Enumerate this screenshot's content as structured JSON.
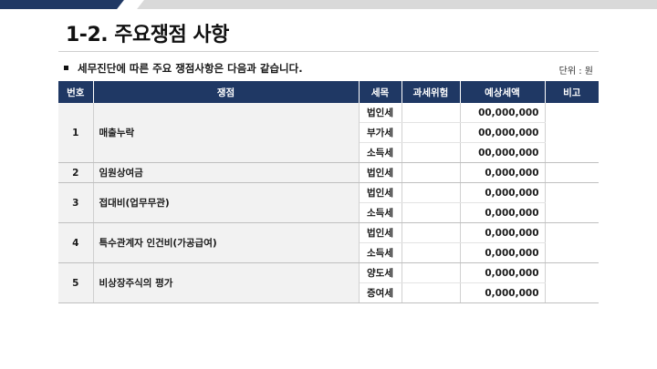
{
  "slide": {
    "title": "1-2. 주요쟁점 사항",
    "bullet": "세무진단에 따른 주요 쟁점사항은 다음과 같습니다.",
    "unit": "단위 : 원"
  },
  "table": {
    "headers": {
      "no": "번호",
      "issue": "쟁점",
      "tax_item": "세목",
      "risk": "과세위험",
      "amount": "예상세액",
      "note": "비고"
    },
    "groups": [
      {
        "no": "1",
        "issue": "매출누락",
        "rows": [
          {
            "tax": "법인세",
            "risk": "",
            "amount": "00,000,000"
          },
          {
            "tax": "부가세",
            "risk": "",
            "amount": "00,000,000"
          },
          {
            "tax": "소득세",
            "risk": "",
            "amount": "00,000,000"
          }
        ]
      },
      {
        "no": "2",
        "issue": "임원상여금",
        "rows": [
          {
            "tax": "법인세",
            "risk": "",
            "amount": "0,000,000"
          }
        ]
      },
      {
        "no": "3",
        "issue": "접대비(업무무관)",
        "rows": [
          {
            "tax": "법인세",
            "risk": "",
            "amount": "0,000,000"
          },
          {
            "tax": "소득세",
            "risk": "",
            "amount": "0,000,000"
          }
        ]
      },
      {
        "no": "4",
        "issue": "특수관계자 인건비(가공급여)",
        "rows": [
          {
            "tax": "법인세",
            "risk": "",
            "amount": "0,000,000"
          },
          {
            "tax": "소득세",
            "risk": "",
            "amount": "0,000,000"
          }
        ]
      },
      {
        "no": "5",
        "issue": "비상장주식의 평가",
        "rows": [
          {
            "tax": "양도세",
            "risk": "",
            "amount": "0,000,000"
          },
          {
            "tax": "증여세",
            "risk": "",
            "amount": "0,000,000"
          }
        ]
      }
    ]
  },
  "colors": {
    "header_bg": "#1f3864",
    "label_bg": "#f2f2f2",
    "accent_bar_dark": "#1f3864",
    "accent_bar_light": "#d9d9d9"
  }
}
